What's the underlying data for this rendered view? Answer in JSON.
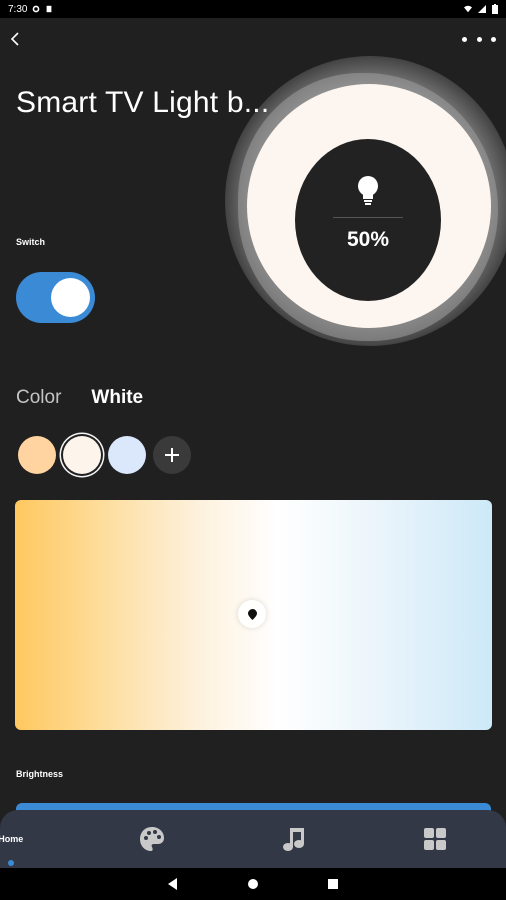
{
  "status_bar": {
    "time": "7:30",
    "left_icons": [
      "settings-icon",
      "storage-icon"
    ],
    "right_icons": [
      "wifi-icon",
      "signal-icon",
      "battery-icon"
    ]
  },
  "header": {
    "title": "Smart TV Light b...",
    "back_icon": "chevron-left-icon",
    "more_icon": "more-dots-icon"
  },
  "dial": {
    "icon": "lightbulb-icon",
    "brightness_text": "50%",
    "ring_color": "#fdf5ef"
  },
  "switch": {
    "label": "Switch",
    "state": "on",
    "color": "#3b8ad6"
  },
  "mode_tabs": [
    {
      "label": "Color",
      "active": false
    },
    {
      "label": "White",
      "active": true
    }
  ],
  "presets": [
    {
      "color": "#ffd4a1",
      "selected": false
    },
    {
      "color": "#fdf5ec",
      "selected": true
    },
    {
      "color": "#dbe8fb",
      "selected": false
    }
  ],
  "add_preset_icon": "plus-icon",
  "temperature_panel": {
    "gradient_start": "#ffc85f",
    "gradient_end": "#cde9f8",
    "picker_position": 0.5
  },
  "brightness": {
    "label": "Brightness"
  },
  "bottom_nav": [
    {
      "label": "Home",
      "icon": "home",
      "active": true
    },
    {
      "label": "",
      "icon": "palette-icon",
      "active": false
    },
    {
      "label": "",
      "icon": "music-icon",
      "active": false
    },
    {
      "label": "",
      "icon": "grid-icon",
      "active": false
    }
  ],
  "system_nav": [
    "back-triangle-icon",
    "home-circle-icon",
    "recents-square-icon"
  ]
}
